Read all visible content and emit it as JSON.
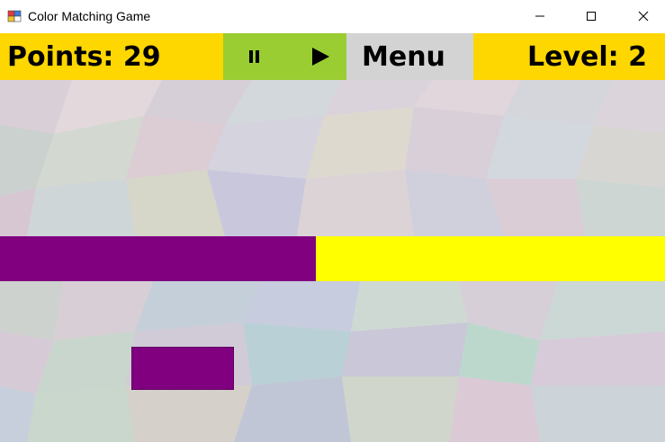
{
  "window": {
    "title": "Color Matching Game",
    "icon": "app-icon",
    "controls": {
      "minimize_icon": "minimize-icon",
      "maximize_icon": "maximize-icon",
      "close_icon": "close-icon"
    }
  },
  "hud": {
    "points_text": "Points: 29",
    "menu_label": "Menu",
    "level_text": "Level: 2",
    "pause_icon": "pause-icon",
    "play_icon": "play-icon",
    "colors": {
      "points_bg": "#ffd700",
      "controls_bg": "#9acd32",
      "menu_bg": "#d3d3d3",
      "level_bg": "#ffd700"
    }
  },
  "game": {
    "barrier": {
      "left_color": "#800080",
      "right_color": "#ffff00"
    },
    "player_block": {
      "color": "#800080"
    }
  }
}
